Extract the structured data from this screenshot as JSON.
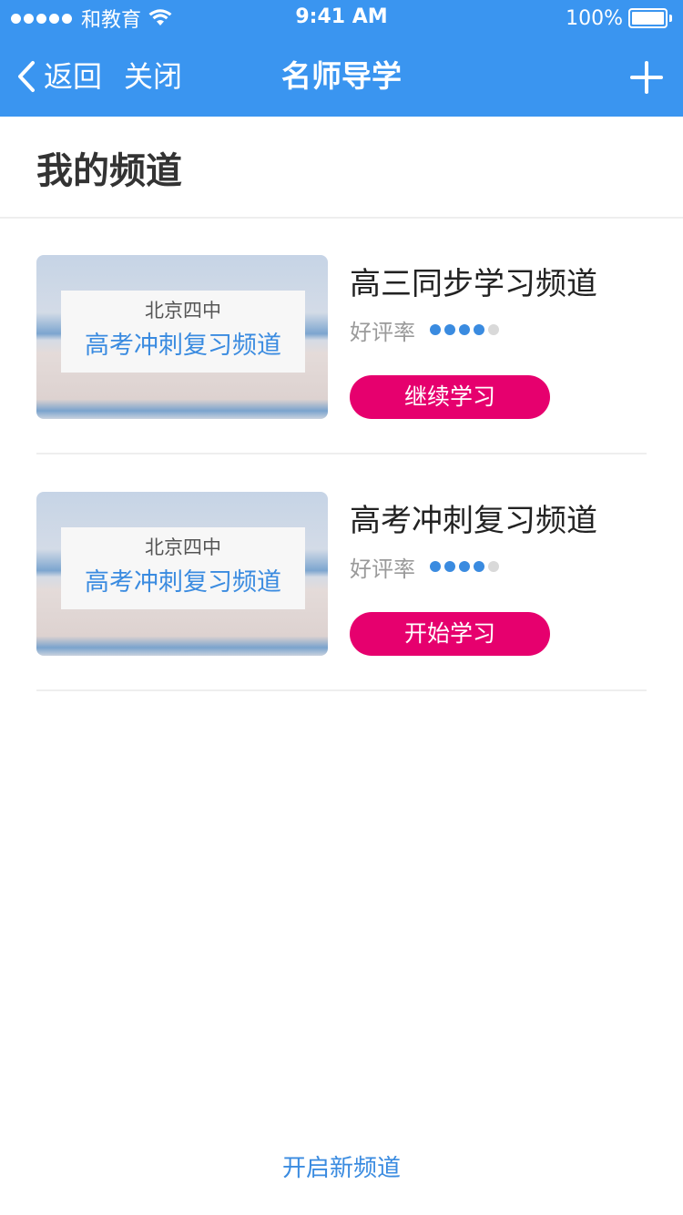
{
  "status_bar": {
    "carrier": "和教育",
    "time": "9:41 AM",
    "battery": "100%",
    "icons": [
      "signal-dots",
      "wifi-icon",
      "battery-icon"
    ]
  },
  "nav": {
    "back_label": "返回",
    "close_label": "关闭",
    "title": "名师导学",
    "add_icon": "plus-icon",
    "color": "#3a95f0"
  },
  "section": {
    "title": "我的频道"
  },
  "channels": [
    {
      "thumb_school": "北京四中",
      "thumb_name": "高考冲刺复习频道",
      "title": "高三同步学习频道",
      "rating_label": "好评率",
      "rating": 4,
      "rating_max": 5,
      "button_label": "继续学习"
    },
    {
      "thumb_school": "北京四中",
      "thumb_name": "高考冲刺复习频道",
      "title": "高考冲刺复习频道",
      "rating_label": "好评率",
      "rating": 4,
      "rating_max": 5,
      "button_label": "开始学习"
    }
  ],
  "footer": {
    "link_label": "开启新频道"
  },
  "colors": {
    "accent": "#3a8be0",
    "button": "#e6006e",
    "rating_filled": "#3a8be0",
    "rating_empty": "#d9d9d9"
  }
}
